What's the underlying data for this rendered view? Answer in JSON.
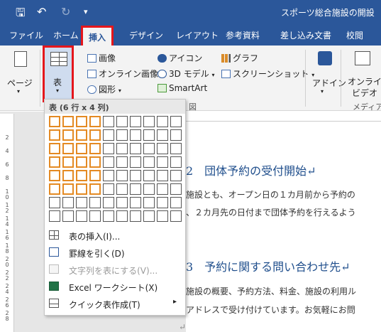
{
  "window": {
    "title": "スポーツ総合施設の開設"
  },
  "quick_access": {
    "save_icon": "save-icon",
    "undo_icon": "undo-icon",
    "redo_icon": "redo-icon",
    "customize_icon": "customize-icon"
  },
  "tabs": [
    "ファイル",
    "ホーム",
    "挿入",
    "デザイン",
    "レイアウト",
    "参考資料",
    "差し込み文書",
    "校閲"
  ],
  "ribbon": {
    "pages_label": "ページ",
    "table_label": "表",
    "picture": "画像",
    "online_picture": "オンライン画像",
    "shapes": "図形",
    "icons": "アイコン",
    "model3d": "3D モデル",
    "smartart": "SmartArt",
    "chart": "グラフ",
    "screenshot": "スクリーンショット",
    "addin": "アドイン",
    "online_video_1": "オンライン",
    "online_video_2": "ビデオ",
    "group_illust": "図",
    "group_media": "メディア"
  },
  "table_menu": {
    "header": "表 (6 行 x 4 列)",
    "selected_rows": 6,
    "selected_cols": 4,
    "grid_rows": 8,
    "grid_cols": 10,
    "items": [
      {
        "label": "表の挿入(I)...",
        "icon": "insert-table-icon",
        "enabled": true
      },
      {
        "label": "罫線を引く(D)",
        "icon": "draw-table-icon",
        "enabled": true
      },
      {
        "label": "文字列を表にする(V)...",
        "icon": "convert-text-icon",
        "enabled": false
      },
      {
        "label": "Excel ワークシート(X)",
        "icon": "excel-icon",
        "enabled": true
      },
      {
        "label": "クイック表作成(T)",
        "icon": "quick-table-icon",
        "enabled": true
      }
    ]
  },
  "document": {
    "heading1": "2　団体予約の受付開始↵",
    "para1_line1": "施設とも、オープン日の１カ月前から予約の",
    "para1_line2": "、２カ月先の日付まで団体予約を行えるよう",
    "heading2": "3　予約に関する問い合わせ先↵",
    "para2_line1": "施設の概要、予約方法、料金、施設の利用ル",
    "para2_line2": "アドレスで受け付けています。お気軽にお問",
    "para_mark": "↵"
  },
  "ruler": {
    "numbers": [
      "2",
      "4",
      "6",
      "8",
      "10",
      "12",
      "14",
      "16",
      "18",
      "20",
      "22",
      "24",
      "26",
      "28"
    ]
  }
}
